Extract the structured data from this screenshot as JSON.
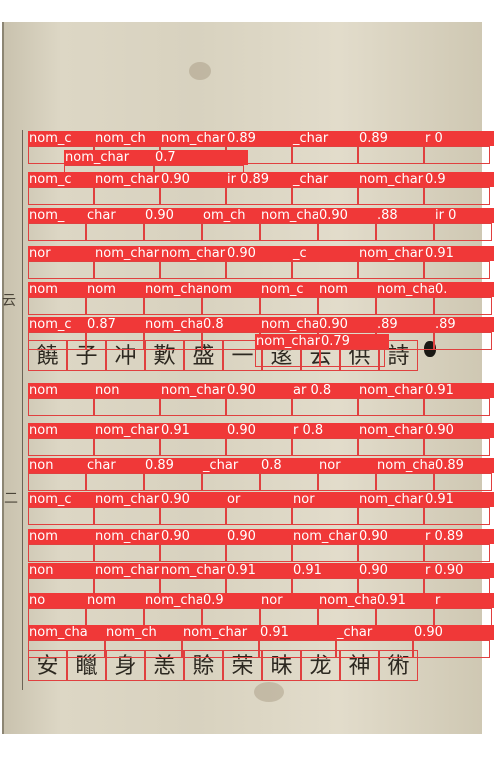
{
  "detection_class": "nom_char",
  "label_rows": [
    {
      "labels": [
        "nom_c",
        "nom_ch",
        "nom_char",
        "0.89",
        "_char",
        "0.89",
        "r 0"
      ]
    },
    {
      "labels": [
        "nom_char",
        "0.7"
      ]
    },
    {
      "labels": [
        "nom_c",
        "nom_char",
        "0.90",
        "ir 0.89",
        "_char",
        "nom_char",
        "0.9"
      ]
    },
    {
      "labels": [
        "nom_",
        "char",
        "0.90",
        "om_ch",
        "nom_char",
        "0.90",
        ".88",
        "ir 0"
      ]
    },
    {
      "labels": [
        "nor",
        "nom_char",
        "nom_char",
        "0.90",
        "_c",
        "nom_char",
        "0.91"
      ]
    },
    {
      "labels": [
        "nom",
        "nom",
        "nom_char",
        "nom",
        "nom_c",
        "nom",
        "nom_char",
        "0."
      ]
    },
    {
      "labels": [
        "nom_c",
        "0.87",
        "nom_char",
        "0.8",
        "nom_char",
        "0.90",
        ".89",
        ".89"
      ]
    },
    {
      "labels": [
        "nom_char",
        "0.79"
      ]
    },
    {
      "labels": [
        "nom",
        "non",
        "nom_char",
        "0.90",
        "ar 0.8",
        "nom_char",
        "0.91"
      ]
    },
    {
      "labels": [
        "nom",
        "nom_char",
        "0.91",
        "0.90",
        "r 0.8",
        "nom_char",
        "0.90"
      ]
    },
    {
      "labels": [
        "non",
        "char",
        "0.89",
        "_char",
        "0.8",
        "nor",
        "nom_char",
        "0.89"
      ]
    },
    {
      "labels": [
        "nom_c",
        "nom_char",
        "0.90",
        "or",
        "nor",
        "nom_char",
        "0.91"
      ]
    },
    {
      "labels": [
        "nom",
        "nom_char",
        "0.90",
        "0.90",
        "nom_char",
        "0.90",
        "r 0.89"
      ]
    },
    {
      "labels": [
        "non",
        "nom_char",
        "nom_char",
        "0.91",
        "0.91",
        "0.90",
        "r 0.90"
      ]
    },
    {
      "labels": [
        "no",
        "nom",
        "nom_char",
        "0.9",
        "nor",
        "nom_char",
        "0.91",
        "r"
      ]
    },
    {
      "labels": [
        "nom_cha",
        "nom_ch",
        "nom_char",
        "0.91",
        "_char",
        "0.90"
      ]
    }
  ],
  "visible_chars_row7": [
    "饒",
    "子",
    "冲",
    "歎",
    "盛",
    "一",
    "逺",
    "云",
    "供",
    "詩"
  ],
  "visible_chars_bottom": [
    "安",
    "䁽",
    "身",
    "恙",
    "賒",
    "荣",
    "昧",
    "龙",
    "神",
    "術"
  ],
  "margin_glyphs": [
    "云",
    "二"
  ]
}
